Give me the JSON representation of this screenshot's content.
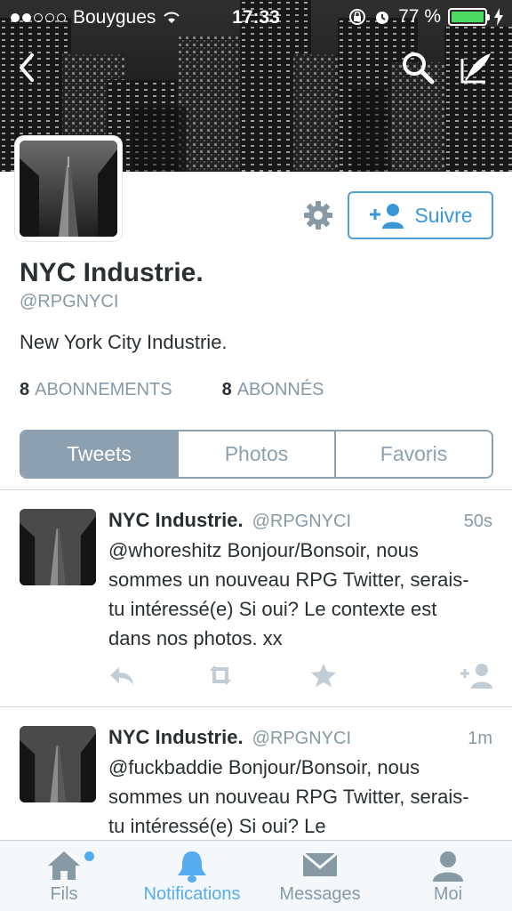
{
  "status_bar": {
    "carrier": "Bouygues",
    "time": "17:33",
    "battery": "77 %"
  },
  "profile": {
    "name": "NYC Industrie.",
    "handle": "@RPGNYCI",
    "bio": "New York City Industrie.",
    "follow_label": "Suivre",
    "following_count": "8",
    "following_label": "ABONNEMENTS",
    "followers_count": "8",
    "followers_label": "ABONNÉS"
  },
  "segments": [
    {
      "label": "Tweets",
      "active": true
    },
    {
      "label": "Photos",
      "active": false
    },
    {
      "label": "Favoris",
      "active": false
    }
  ],
  "tweets": [
    {
      "name": "NYC Industrie.",
      "handle": "@RPGNYCI",
      "age": "50s",
      "text": "@whoreshitz Bonjour/Bonsoir, nous sommes un nouveau RPG Twitter, serais-tu intéressé(e) Si oui? Le contexte est dans nos photos. xx"
    },
    {
      "name": "NYC Industrie.",
      "handle": "@RPGNYCI",
      "age": "1m",
      "text": "@fuckbaddie Bonjour/Bonsoir, nous sommes un nouveau RPG Twitter, serais-tu intéressé(e) Si oui? Le"
    }
  ],
  "tabbar": [
    {
      "label": "Fils",
      "icon": "home-icon",
      "active": false
    },
    {
      "label": "Notifications",
      "icon": "bell-icon",
      "active": true
    },
    {
      "label": "Messages",
      "icon": "envelope-icon",
      "active": false
    },
    {
      "label": "Moi",
      "icon": "person-icon",
      "active": false
    }
  ],
  "colors": {
    "accent": "#55acee",
    "segment": "#8da0b0",
    "battery": "#4cd964"
  }
}
